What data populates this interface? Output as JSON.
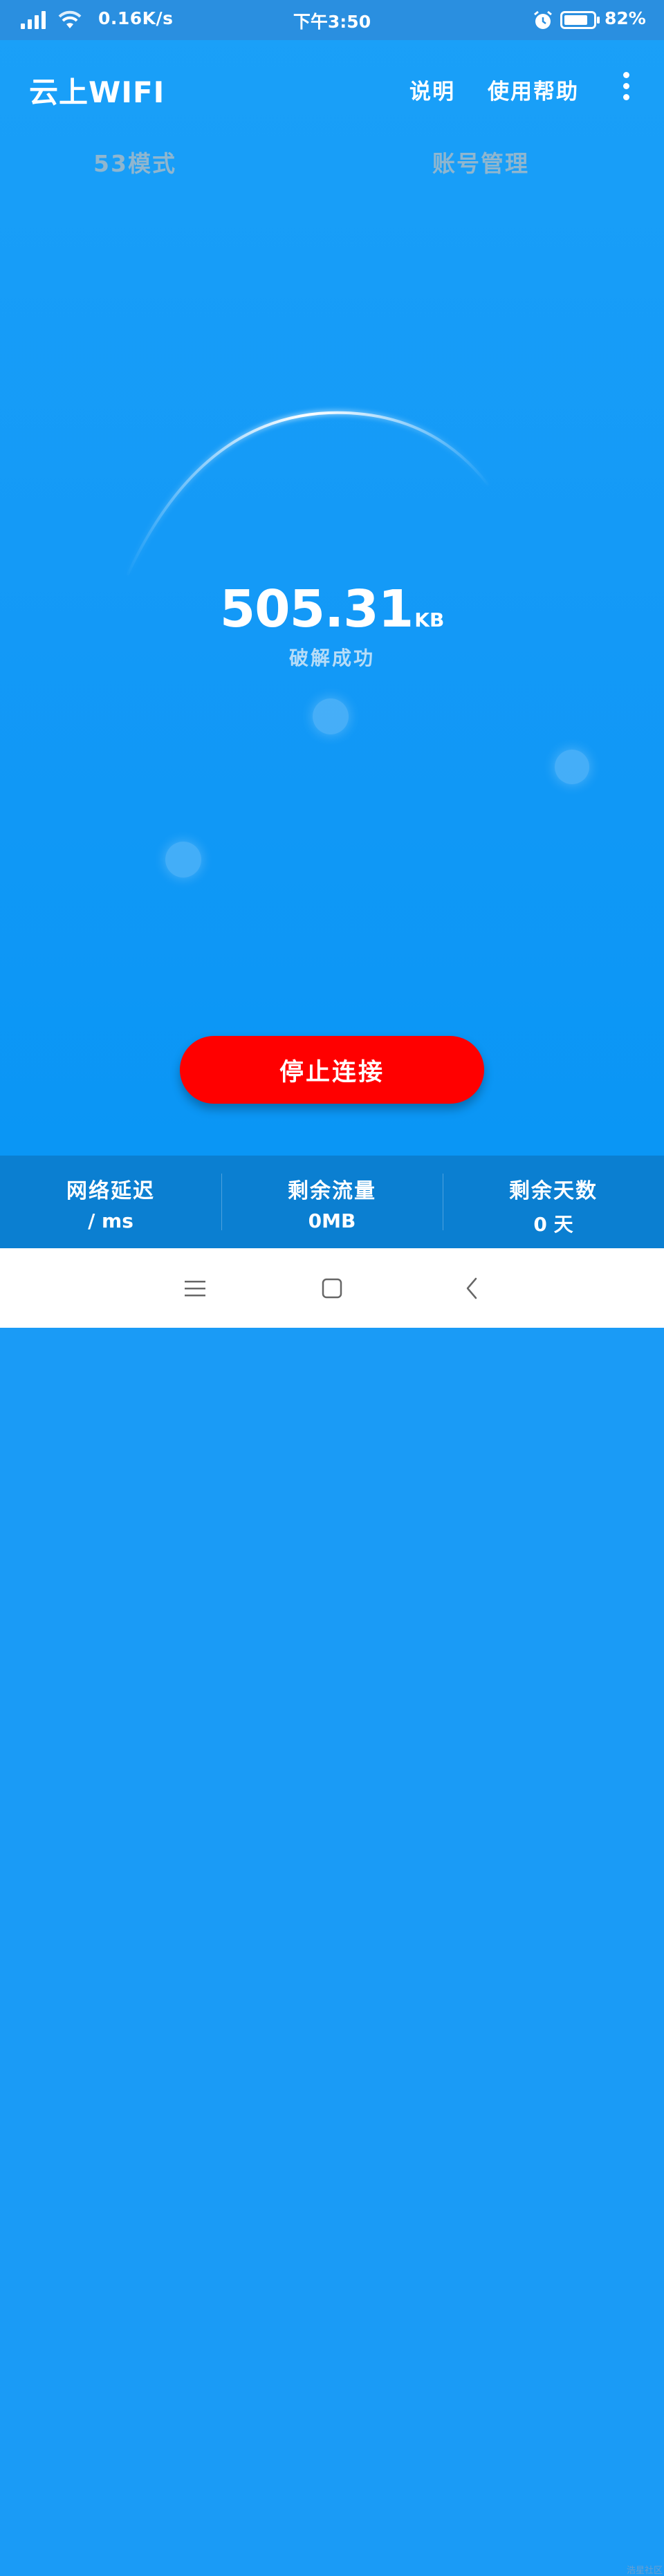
{
  "status_bar": {
    "net_speed": "0.16K/s",
    "time": "下午3:50",
    "battery": "82%"
  },
  "toolbar": {
    "title": "云上WIFI",
    "explain_label": "说明",
    "help_label": "使用帮助"
  },
  "tabs": [
    {
      "label": "53模式"
    },
    {
      "label": "账号管理"
    }
  ],
  "gauge": {
    "value": "505.31",
    "unit": "KB",
    "status": "破解成功"
  },
  "action": {
    "stop_label": "停止连接"
  },
  "stats": [
    {
      "label": "网络延迟",
      "value": "/ ms"
    },
    {
      "label": "剩余流量",
      "value": "0MB"
    },
    {
      "label": "剩余天数",
      "value": "0 天"
    }
  ],
  "watermark": "浩星社区",
  "icons": {
    "signal": "signal-bars-icon",
    "wifi": "wifi-icon",
    "alarm": "alarm-icon",
    "battery": "battery-icon",
    "more": "more-vertical-icon",
    "menu": "menu-icon",
    "home": "home-icon",
    "back": "back-icon"
  },
  "colors": {
    "primary": "#1a9bf6",
    "status_bar": "#2a8fe0",
    "stats_bar": "#0b7fd1",
    "stop_button": "#ff0000",
    "tab_text": "#8fb6cf"
  }
}
